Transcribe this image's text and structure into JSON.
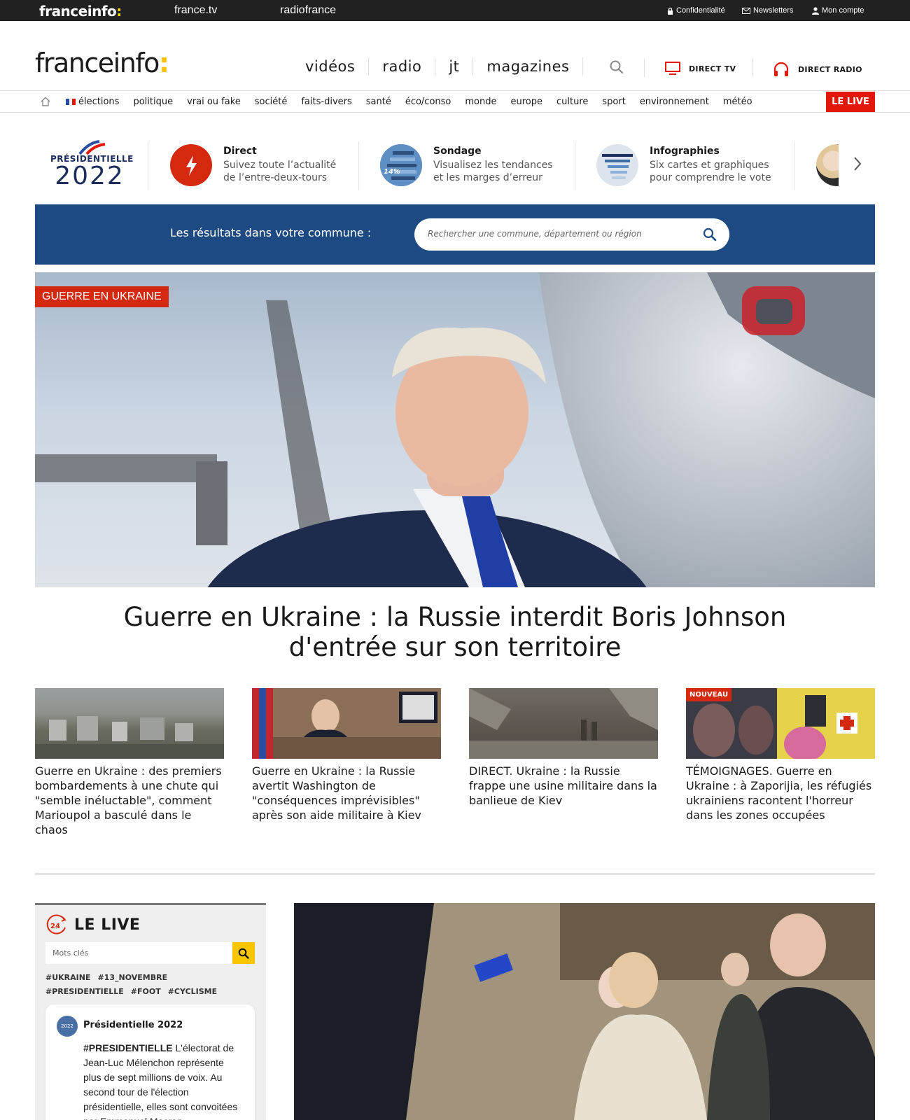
{
  "topbar": {
    "brand": "franceinfo",
    "brand_colon": ":",
    "links": [
      "france.tv",
      "radiofrance"
    ],
    "confidentialite": "Confidentialité",
    "newsletters": "Newsletters",
    "compte": "Mon compte"
  },
  "header": {
    "logo": "franceinfo",
    "logo_colon": ":",
    "nav": [
      "vidéos",
      "radio",
      "jt",
      "magazines"
    ],
    "direct_tv": "DIRECT TV",
    "direct_radio": "DIRECT RADIO"
  },
  "categories": [
    "élections",
    "politique",
    "vrai ou fake",
    "société",
    "faits-divers",
    "santé",
    "éco/conso",
    "monde",
    "europe",
    "culture",
    "sport",
    "environnement",
    "météo"
  ],
  "live_button": "LE LIVE",
  "presidentielle": {
    "line1": "PRÉSIDENTIELLE",
    "line2": "2022",
    "cards": [
      {
        "title": "Direct",
        "desc1": "Suivez toute l’actualité",
        "desc2": "de l’entre-deux-tours"
      },
      {
        "title": "Sondage",
        "desc1": "Visualisez les tendances",
        "desc2": "et les marges d’erreur"
      },
      {
        "title": "Infographies",
        "desc1": "Six cartes et graphiques",
        "desc2": "pour comprendre le vote"
      }
    ],
    "sondage_badge": "14%"
  },
  "commune": {
    "label": "Les résultats dans votre commune :",
    "placeholder": "Rechercher une commune, département ou région"
  },
  "hero": {
    "tag": "GUERRE EN UKRAINE",
    "title_line1": "Guerre en Ukraine : la Russie interdit Boris Johnson",
    "title_line2": "d'entrée sur son territoire"
  },
  "articles": [
    {
      "title": "Guerre en Ukraine : des premiers bombardements à une chute qui \"semble inéluctable\", comment Marioupol a basculé dans le chaos",
      "badge": ""
    },
    {
      "title": "Guerre en Ukraine : la Russie avertit Washington de \"conséquences imprévisibles\" après son aide militaire à Kiev",
      "badge": ""
    },
    {
      "title": "DIRECT. Ukraine : la Russie frappe une usine militaire dans la banlieue de Kiev",
      "badge": ""
    },
    {
      "title": "TÉMOIGNAGES. Guerre en Ukraine : à Zaporijia, les réfugiés ukrainiens racontent l'horreur dans les zones occupées",
      "badge": "NOUVEAU"
    }
  ],
  "live_panel": {
    "title": "LE LIVE",
    "icon_text": "24",
    "keywords_placeholder": "Mots clés",
    "tags": [
      "#UKRAINE",
      "#13_NOVEMBRE",
      "#PRESIDENTIELLE",
      "#FOOT",
      "#CYCLISME"
    ],
    "tweet": {
      "author": "Présidentielle 2022",
      "avatar_text": "2022",
      "hashtag": "#PRESIDENTIELLE",
      "text": " L'électorat de Jean-Luc Mélenchon représente plus de sept millions de voix. Au second tour de l'élection présidentielle, elles sont convoitées par Emmanuel Macron"
    }
  },
  "colors": {
    "topbar": "#212121",
    "accent_yellow": "#ffc107",
    "live_red": "#e3170a",
    "commune_blue": "#1d4a83",
    "tag_red": "#d4290e"
  }
}
